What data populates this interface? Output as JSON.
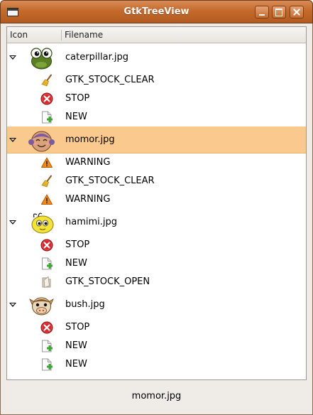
{
  "window": {
    "title": "GtkTreeView",
    "buttons": {
      "minimize": "minimize",
      "maximize": "maximize",
      "close": "close"
    }
  },
  "tree": {
    "columns": [
      "Icon",
      "Filename"
    ],
    "groups": [
      {
        "filename": "caterpillar.jpg",
        "thumbnail": "caterpillar-face-icon",
        "expanded": true,
        "children": [
          {
            "label": "GTK_STOCK_CLEAR",
            "icon": "broom-clear-icon"
          },
          {
            "label": "STOP",
            "icon": "stop-icon"
          },
          {
            "label": "NEW",
            "icon": "new-document-icon"
          }
        ]
      },
      {
        "filename": "momor.jpg",
        "thumbnail": "momor-face-icon",
        "expanded": true,
        "selected": true,
        "children": [
          {
            "label": "WARNING",
            "icon": "warning-icon"
          },
          {
            "label": "GTK_STOCK_CLEAR",
            "icon": "broom-clear-icon"
          },
          {
            "label": "WARNING",
            "icon": "warning-icon"
          }
        ]
      },
      {
        "filename": "hamimi.jpg",
        "thumbnail": "hamimi-face-icon",
        "expanded": true,
        "children": [
          {
            "label": "STOP",
            "icon": "stop-icon"
          },
          {
            "label": "NEW",
            "icon": "new-document-icon"
          },
          {
            "label": "GTK_STOCK_OPEN",
            "icon": "open-icon"
          }
        ]
      },
      {
        "filename": "bush.jpg",
        "thumbnail": "bush-face-icon",
        "expanded": true,
        "children": [
          {
            "label": "STOP",
            "icon": "stop-icon"
          },
          {
            "label": "NEW",
            "icon": "new-document-icon"
          },
          {
            "label": "NEW",
            "icon": "new-document-icon"
          }
        ]
      }
    ]
  },
  "statusbar": {
    "text": "momor.jpg"
  },
  "colors": {
    "titlebar": "#c46a2c",
    "selection": "#f9c98d",
    "window_bg": "#efebe7",
    "stop_red": "#d8262b",
    "new_plus": "#3fa536",
    "warning_orange": "#f28a12"
  }
}
